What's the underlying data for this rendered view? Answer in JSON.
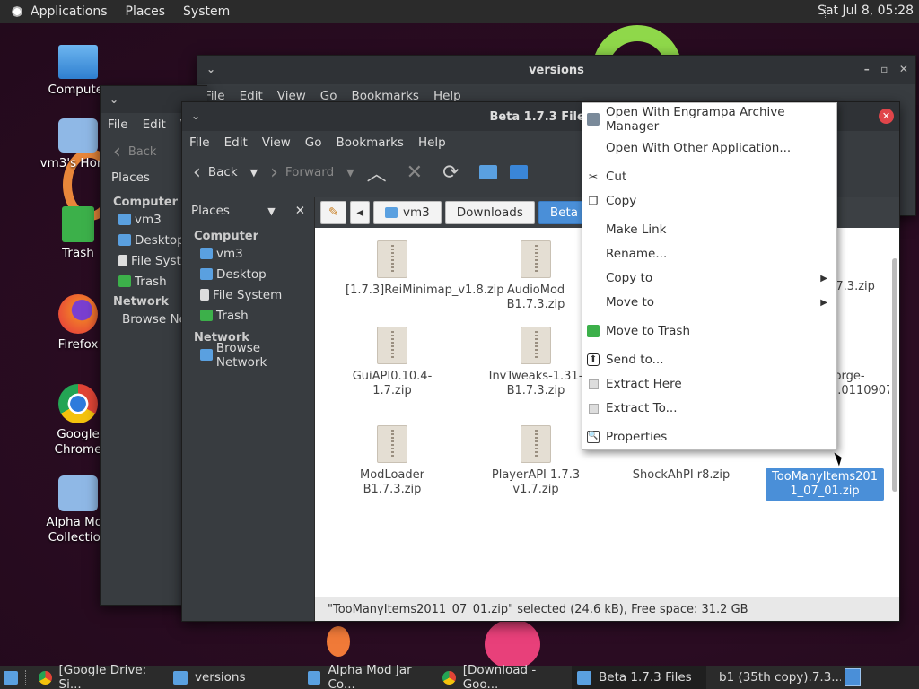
{
  "topbar": {
    "applications": "Applications",
    "places": "Places",
    "system": "System",
    "clock": "Sat Jul  8, 05:28"
  },
  "desktop": {
    "icons": [
      {
        "label": "Computer"
      },
      {
        "label": "vm3's Home"
      },
      {
        "label": "Trash"
      },
      {
        "label": "Firefox"
      },
      {
        "label": "Google Chrome"
      },
      {
        "label": "Alpha Mod Collection"
      }
    ]
  },
  "win_back": {
    "title": "versions",
    "menu": [
      "File",
      "Edit",
      "View",
      "Go",
      "Bookmarks",
      "Help"
    ]
  },
  "win_mid": {
    "menu": [
      "File",
      "Edit",
      "V"
    ],
    "back": "Back",
    "places": "Places",
    "computer": "Computer",
    "items": [
      "vm3",
      "Desktop",
      "File System",
      "Trash"
    ],
    "network": "Network",
    "browse": "Browse Network"
  },
  "main": {
    "title": "Beta 1.7.3 Files",
    "menu": [
      "File",
      "Edit",
      "View",
      "Go",
      "Bookmarks",
      "Help"
    ],
    "toolbar": {
      "back": "Back",
      "forward": "Forward"
    },
    "sidebar": {
      "header": "Places",
      "computer": "Computer",
      "items": [
        "vm3",
        "Desktop",
        "File System",
        "Trash"
      ],
      "network": "Network",
      "browse": "Browse Network"
    },
    "path": [
      "vm3",
      "Downloads",
      "Beta 1"
    ],
    "files": [
      {
        "name": "[1.7.3]ReiMinimap_v1.8.zip"
      },
      {
        "name": "AudioMod B1.7.3.zip"
      },
      {
        "name": "1.7.3.zip"
      },
      {
        "name": "GuiAPI0.10.4-1.7.zip"
      },
      {
        "name": "InvTweaks-1.31-B1.7.3.zip"
      },
      {
        "name": "forge-1.0110907."
      },
      {
        "name": "ModLoader B1.7.3.zip"
      },
      {
        "name": "PlayerAPI 1.7.3 v1.7.zip"
      },
      {
        "name": "ShockAhPI r8.zip"
      },
      {
        "name": "TooManyItems2011_07_01.zip"
      }
    ],
    "status": "\"TooManyItems2011_07_01.zip\" selected (24.6 kB), Free space: 31.2 GB"
  },
  "context_menu": [
    {
      "label": "Open With Engrampa Archive Manager",
      "icon": "archive-icon"
    },
    {
      "label": "Open With Other Application...",
      "icon": ""
    },
    {
      "label": "Cut",
      "icon": "scissors-icon"
    },
    {
      "label": "Copy",
      "icon": "copy-icon"
    },
    {
      "label": "Make Link",
      "icon": ""
    },
    {
      "label": "Rename...",
      "icon": ""
    },
    {
      "label": "Copy to",
      "icon": "",
      "submenu": true
    },
    {
      "label": "Move to",
      "icon": "",
      "submenu": true
    },
    {
      "label": "Move to Trash",
      "icon": "trash-icon"
    },
    {
      "label": "Send to...",
      "icon": "send-icon"
    },
    {
      "label": "Extract Here",
      "icon": "extract-icon"
    },
    {
      "label": "Extract To...",
      "icon": "extract-icon"
    },
    {
      "label": "Properties",
      "icon": "properties-icon"
    }
  ],
  "taskbar": [
    {
      "label": "[Google Drive: Si...",
      "icon": "chrome-icon"
    },
    {
      "label": "versions",
      "icon": "folder-icon"
    },
    {
      "label": "Alpha Mod Jar Co...",
      "icon": "folder-icon"
    },
    {
      "label": "[Download - Goo...",
      "icon": "chrome-icon"
    },
    {
      "label": "Beta 1.7.3 Files",
      "icon": "folder-icon",
      "active": true
    },
    {
      "label": "b1 (35th copy).7.3....",
      "icon": "archive-icon"
    }
  ]
}
